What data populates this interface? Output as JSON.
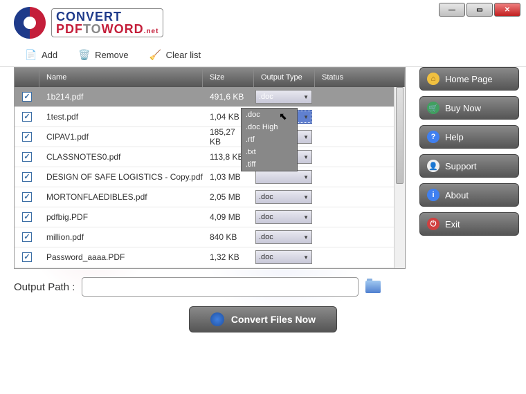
{
  "logo": {
    "line1a": "CONVERT",
    "line2a": "PDF",
    "line2b": "TO",
    "line2c": "WORD",
    "suffix": ".net"
  },
  "toolbar": {
    "add": "Add",
    "remove": "Remove",
    "clear": "Clear list"
  },
  "headers": {
    "name": "Name",
    "size": "Size",
    "otype": "Output Type",
    "status": "Status"
  },
  "rows": [
    {
      "checked": true,
      "name": "1b214.pdf",
      "size": "491,6 KB",
      "otype": ".doc",
      "selected": true
    },
    {
      "checked": true,
      "name": "1test.pdf",
      "size": "1,04 KB",
      "otype": ".doc",
      "open": true
    },
    {
      "checked": true,
      "name": "CIPAV1.pdf",
      "size": "185,27 KB",
      "otype": ""
    },
    {
      "checked": true,
      "name": "CLASSNOTES0.pdf",
      "size": "113,8 KB",
      "otype": ""
    },
    {
      "checked": true,
      "name": "DESIGN OF SAFE LOGISTICS - Copy.pdf",
      "size": "1,03 MB",
      "otype": ""
    },
    {
      "checked": true,
      "name": "MORTONFLAEDIBLES.pdf",
      "size": "2,05 MB",
      "otype": ".doc"
    },
    {
      "checked": true,
      "name": "pdfbig.PDF",
      "size": "4,09 MB",
      "otype": ".doc"
    },
    {
      "checked": true,
      "name": "million.pdf",
      "size": "840 KB",
      "otype": ".doc"
    },
    {
      "checked": true,
      "name": "Password_aaaa.PDF",
      "size": "1,32 KB",
      "otype": ".doc"
    }
  ],
  "dropdown": [
    ".doc",
    ".doc High",
    ".rtf",
    ".txt",
    ".tiff"
  ],
  "sidebar": {
    "home": "Home Page",
    "buy": "Buy Now",
    "help": "Help",
    "support": "Support",
    "about": "About",
    "exit": "Exit"
  },
  "outpath": {
    "label": "Output Path :",
    "value": ""
  },
  "convert": "Convert Files Now"
}
